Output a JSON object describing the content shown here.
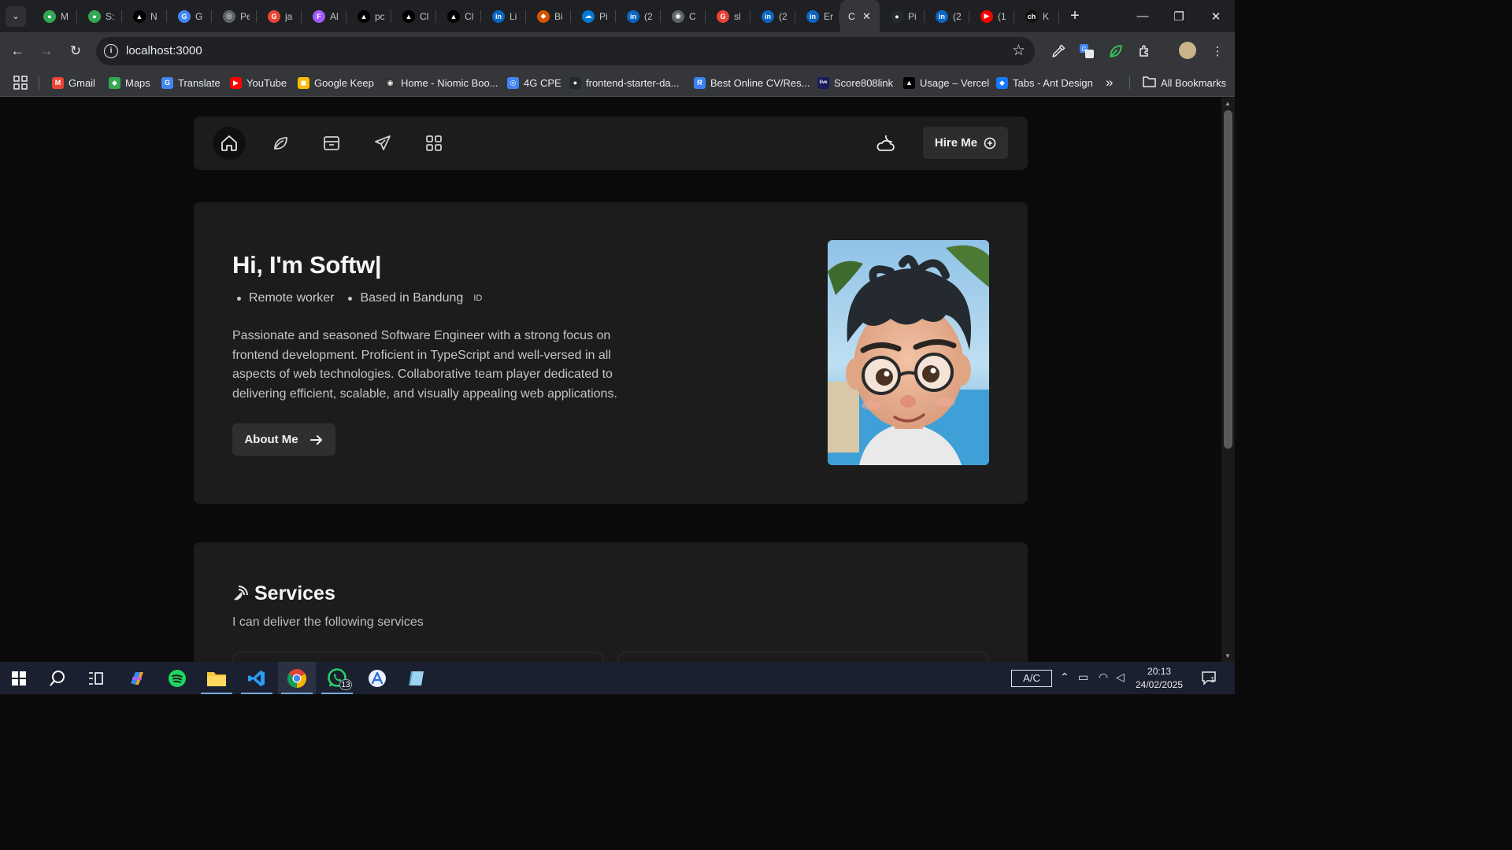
{
  "browser": {
    "tabs": [
      {
        "fav": "●",
        "color": "#34a853",
        "title": "M"
      },
      {
        "fav": "●",
        "color": "#34a853",
        "title": "S:"
      },
      {
        "fav": "▲",
        "color": "#000000",
        "title": "N"
      },
      {
        "fav": "G",
        "color": "#4285f4",
        "title": "G"
      },
      {
        "fav": "◎",
        "color": "#5f6368",
        "title": "Pe"
      },
      {
        "fav": "G",
        "color": "#ea4335",
        "title": "ja"
      },
      {
        "fav": "F",
        "color": "#a259ff",
        "title": "Al"
      },
      {
        "fav": "▲",
        "color": "#000000",
        "title": "pc"
      },
      {
        "fav": "▲",
        "color": "#000000",
        "title": "Cl"
      },
      {
        "fav": "▲",
        "color": "#000000",
        "title": "Cl"
      },
      {
        "fav": "in",
        "color": "#0a66c2",
        "title": "Li"
      },
      {
        "fav": "◆",
        "color": "#d35400",
        "title": "Bi"
      },
      {
        "fav": "☁",
        "color": "#0078d4",
        "title": "Pi"
      },
      {
        "fav": "in",
        "color": "#0a66c2",
        "title": "(2"
      },
      {
        "fav": "◉",
        "color": "#5f6368",
        "title": "C"
      },
      {
        "fav": "G",
        "color": "#ea4335",
        "title": "sl"
      },
      {
        "fav": "in",
        "color": "#0a66c2",
        "title": "(2"
      },
      {
        "fav": "in",
        "color": "#0a66c2",
        "title": "Er"
      }
    ],
    "active_tab": {
      "title": "C",
      "close": "✕"
    },
    "tabs_after": [
      {
        "fav": "●",
        "color": "#24292e",
        "title": "Pi"
      },
      {
        "fav": "in",
        "color": "#0a66c2",
        "title": "(2"
      },
      {
        "fav": "▶",
        "color": "#ff0000",
        "title": "(1"
      },
      {
        "fav": "ch",
        "color": "#111111",
        "title": "K"
      }
    ],
    "new_tab": "+",
    "window_controls": {
      "minimize": "—",
      "restore": "❐",
      "close": "✕"
    },
    "url": "localhost:3000",
    "bookmarks": [
      {
        "label": "Gmail",
        "ico": "M",
        "color": "#ea4335"
      },
      {
        "label": "Maps",
        "ico": "◆",
        "color": "#34a853"
      },
      {
        "label": "Translate",
        "ico": "G",
        "color": "#4285f4"
      },
      {
        "label": "YouTube",
        "ico": "▶",
        "color": "#ff0000"
      },
      {
        "label": "Google Keep",
        "ico": "◼",
        "color": "#fbbc04"
      },
      {
        "label": "Home - Niomic Boo...",
        "ico": "◉",
        "color": "#333333"
      },
      {
        "label": "4G CPE",
        "ico": "◎",
        "color": "#4285f4"
      },
      {
        "label": "frontend-starter-da...",
        "ico": "●",
        "color": "#24292e"
      },
      {
        "label": "Best Online CV/Res...",
        "ico": "R",
        "color": "#3b82f6"
      },
      {
        "label": "Score808link",
        "ico": "live",
        "color": "#1a1a5e"
      },
      {
        "label": "Usage – Vercel",
        "ico": "▲",
        "color": "#000000"
      },
      {
        "label": "Tabs - Ant Design",
        "ico": "◆",
        "color": "#1677ff"
      }
    ],
    "more_bookmarks": "»",
    "all_bookmarks": "All Bookmarks"
  },
  "site": {
    "nav": {
      "icons": [
        "home-icon",
        "leaf-icon",
        "archive-icon",
        "send-icon",
        "grid-icon"
      ],
      "theme_icon": "cloud-moon-icon",
      "hire_label": "Hire Me"
    },
    "hero": {
      "title": "Hi, I'm Softw|",
      "tags": [
        "Remote worker",
        "Based in Bandung"
      ],
      "flag": "ID",
      "bio": "Passionate and seasoned Software Engineer with a strong focus on frontend development. Proficient in TypeScript and well-versed in all aspects of web technologies. Collaborative team player dedicated to delivering efficient, scalable, and visually appealing web applications.",
      "about_label": "About Me"
    },
    "services": {
      "title": "Services",
      "subtitle": "I can deliver the following services"
    }
  },
  "taskbar": {
    "whatsapp_badge": "13",
    "power": "A/C",
    "time": "20:13",
    "date": "24/02/2025",
    "notifications": "1"
  }
}
